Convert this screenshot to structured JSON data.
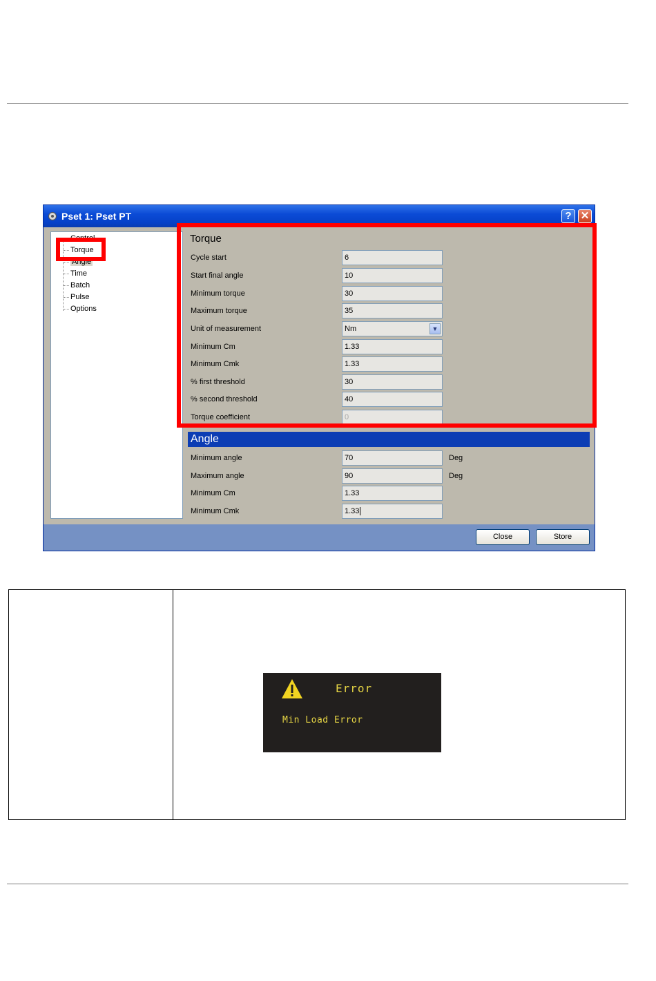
{
  "window": {
    "title": "Pset 1: Pset PT",
    "help_label": "?",
    "close_label": "✕"
  },
  "tree": {
    "items": [
      "Control",
      "Torque",
      "Angle",
      "Time",
      "Batch",
      "Pulse",
      "Options"
    ],
    "selected": "Angle"
  },
  "torque": {
    "title": "Torque",
    "fields": [
      {
        "label": "Cycle start",
        "value": "6"
      },
      {
        "label": "Start final angle",
        "value": "10"
      },
      {
        "label": "Minimum torque",
        "value": "30"
      },
      {
        "label": "Maximum torque",
        "value": "35"
      },
      {
        "label": "Unit of measurement",
        "value": "Nm",
        "type": "select"
      },
      {
        "label": "Minimum Cm",
        "value": "1.33"
      },
      {
        "label": "Minimum Cmk",
        "value": "1.33"
      },
      {
        "label": "% first threshold",
        "value": "30"
      },
      {
        "label": "% second threshold",
        "value": "40"
      },
      {
        "label": "Torque coefficient",
        "value": "0",
        "disabled": true
      }
    ]
  },
  "angle": {
    "title": "Angle",
    "fields": [
      {
        "label": "Minimum angle",
        "value": "70",
        "unit": "Deg"
      },
      {
        "label": "Maximum angle",
        "value": "90",
        "unit": "Deg"
      },
      {
        "label": "Minimum Cm",
        "value": "1.33"
      },
      {
        "label": "Minimum Cmk",
        "value": "1.33"
      }
    ]
  },
  "footer": {
    "close_label": "Close",
    "store_label": "Store"
  },
  "error_display": {
    "title": "Error",
    "message": "Min Load Error"
  },
  "colors": {
    "highlight": "#ff0000",
    "title_bar": "#0b4bd6",
    "section_bar": "#0c3db4",
    "panel": "#bdb9ad",
    "error_text": "#e7d645"
  }
}
